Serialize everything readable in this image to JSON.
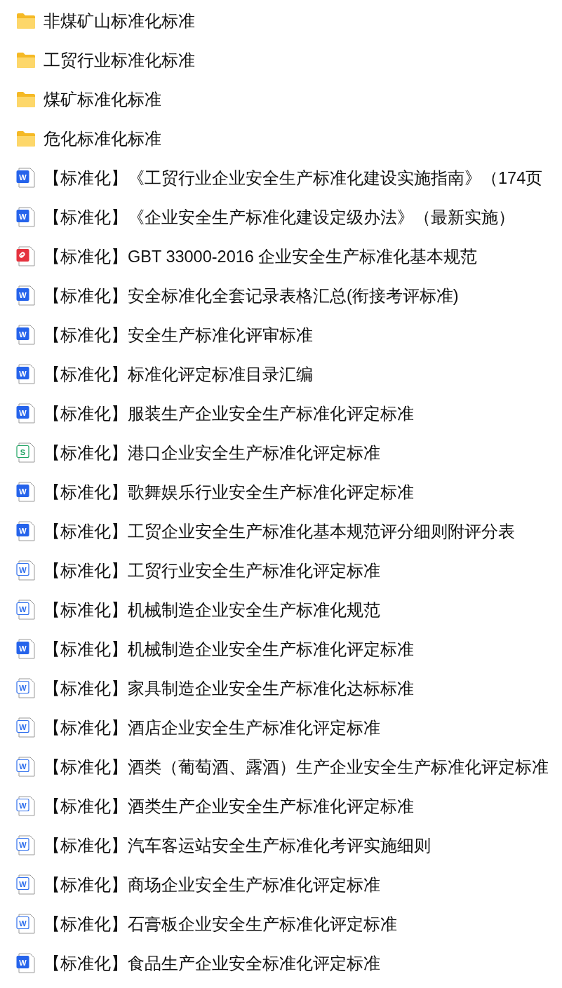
{
  "files": [
    {
      "kind": "folder",
      "name": "非煤矿山标准化标准"
    },
    {
      "kind": "folder",
      "name": "工贸行业标准化标准"
    },
    {
      "kind": "folder",
      "name": "煤矿标准化标准"
    },
    {
      "kind": "folder",
      "name": "危化标准化标准"
    },
    {
      "kind": "doc",
      "glyph": "W",
      "name": "【标准化】《工贸行业企业安全生产标准化建设实施指南》（174页"
    },
    {
      "kind": "doc",
      "glyph": "W",
      "name": "【标准化】《企业安全生产标准化建设定级办法》（最新实施）"
    },
    {
      "kind": "pdf",
      "name": "【标准化】GBT 33000-2016 企业安全生产标准化基本规范"
    },
    {
      "kind": "doc",
      "glyph": "W",
      "name": "【标准化】安全标准化全套记录表格汇总(衔接考评标准)"
    },
    {
      "kind": "doc",
      "glyph": "W",
      "name": "【标准化】安全生产标准化评审标准"
    },
    {
      "kind": "doc",
      "glyph": "W",
      "name": "【标准化】标准化评定标准目录汇编"
    },
    {
      "kind": "doc",
      "glyph": "W",
      "name": "【标准化】服装生产企业安全生产标准化评定标准"
    },
    {
      "kind": "sheet",
      "glyph": "S",
      "name": "【标准化】港口企业安全生产标准化评定标准"
    },
    {
      "kind": "doc",
      "glyph": "W",
      "name": "【标准化】歌舞娱乐行业安全生产标准化评定标准"
    },
    {
      "kind": "doc",
      "glyph": "W",
      "name": "【标准化】工贸企业安全生产标准化基本规范评分细则附评分表"
    },
    {
      "kind": "doc-outline",
      "glyph": "W",
      "name": "【标准化】工贸行业安全生产标准化评定标准"
    },
    {
      "kind": "doc-outline",
      "glyph": "W",
      "name": "【标准化】机械制造企业安全生产标准化规范"
    },
    {
      "kind": "doc",
      "glyph": "W",
      "name": "【标准化】机械制造企业安全生产标准化评定标准"
    },
    {
      "kind": "doc-outline",
      "glyph": "W",
      "name": "【标准化】家具制造企业安全生产标准化达标标准"
    },
    {
      "kind": "doc-outline",
      "glyph": "W",
      "name": "【标准化】酒店企业安全生产标准化评定标准"
    },
    {
      "kind": "doc-outline",
      "glyph": "W",
      "name": "【标准化】酒类（葡萄酒、露酒）生产企业安全生产标准化评定标准"
    },
    {
      "kind": "doc-outline",
      "glyph": "W",
      "name": "【标准化】酒类生产企业安全生产标准化评定标准"
    },
    {
      "kind": "doc-outline",
      "glyph": "W",
      "name": "【标准化】汽车客运站安全生产标准化考评实施细则"
    },
    {
      "kind": "doc-outline",
      "glyph": "W",
      "name": "【标准化】商场企业安全生产标准化评定标准"
    },
    {
      "kind": "doc-outline",
      "glyph": "W",
      "name": "【标准化】石膏板企业安全生产标准化评定标准"
    },
    {
      "kind": "doc",
      "glyph": "W",
      "name": "【标准化】食品生产企业安全标准化评定标准"
    }
  ]
}
